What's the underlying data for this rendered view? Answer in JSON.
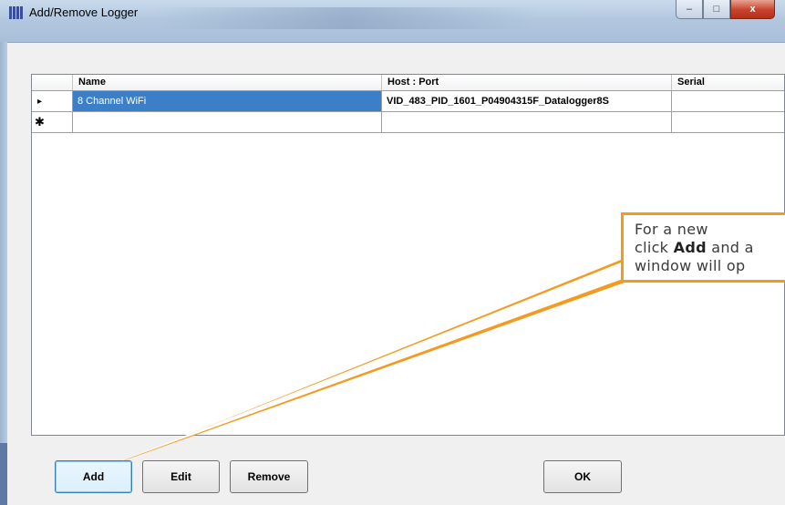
{
  "window": {
    "title": "Add/Remove Logger",
    "minimize_glyph": "–",
    "maximize_glyph": "□",
    "close_glyph": "x"
  },
  "grid": {
    "columns": [
      "Name",
      "Host : Port",
      "Serial"
    ],
    "rows": [
      {
        "indicator": "▸",
        "name": "8 Channel WiFi",
        "host_port": "VID_483_PID_1601_P04904315F_Datalogger8S",
        "serial": "",
        "selected": true
      },
      {
        "indicator": "✱",
        "name": "",
        "host_port": "",
        "serial": "",
        "selected": false
      }
    ]
  },
  "buttons": {
    "add": "Add",
    "edit": "Edit",
    "remove": "Remove",
    "ok": "OK"
  },
  "callout": {
    "line1": "For a new",
    "line2_pre": "click ",
    "line2_bold": "Add",
    "line2_post": " and a",
    "line3": "window will op",
    "border_color": "#f39a22"
  }
}
